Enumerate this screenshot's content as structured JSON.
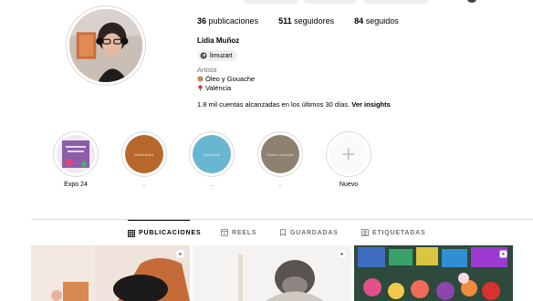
{
  "profile": {
    "username_partial": "limuzart",
    "full_name": "Lidia Muñoz",
    "threads_handle": "limuzart",
    "category": "Artista",
    "bio_line1": "Óleo y Gouache",
    "bio_line2": "València",
    "insights_text": "1.8 mil cuentas alcanzadas en los últimos 30 días.",
    "insights_link": "Ver insights"
  },
  "stats": {
    "posts_count": "36",
    "posts_label": "publicaciones",
    "followers_count": "511",
    "followers_label": "seguidores",
    "following_count": "84",
    "following_label": "seguidos"
  },
  "highlights": [
    {
      "label": "Expo 24",
      "cover_text": "",
      "color": "#b88fc9"
    },
    {
      "label": ".",
      "cover_text": "Materiales",
      "color": "#b8672b"
    },
    {
      "label": ".",
      "cover_text": "Secretos",
      "color": "#69b6d3"
    },
    {
      "label": ".",
      "cover_text": "Sobre conocer",
      "color": "#8e8171"
    },
    {
      "label": "Nuevo",
      "cover_text": "+",
      "color": "#fafafa"
    }
  ],
  "tabs": [
    {
      "label": "PUBLICACIONES",
      "icon": "grid-icon",
      "active": true
    },
    {
      "label": "REELS",
      "icon": "reels-icon",
      "active": false
    },
    {
      "label": "GUARDADAS",
      "icon": "bookmark-icon",
      "active": false
    },
    {
      "label": "ETIQUETADAS",
      "icon": "tagged-icon",
      "active": false
    }
  ],
  "colors": {
    "text_primary": "#000000",
    "text_secondary": "#737373",
    "border": "#dbdbdb",
    "pill_bg": "#efefef"
  }
}
